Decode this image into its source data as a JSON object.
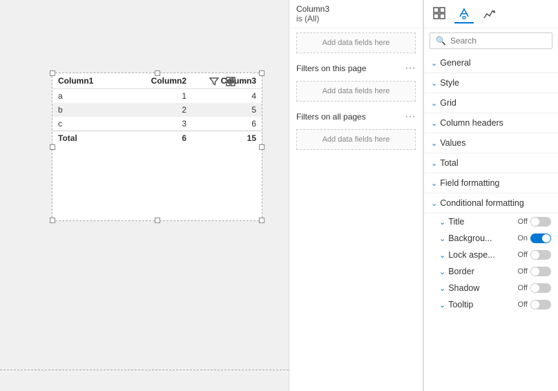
{
  "canvas": {
    "table": {
      "headers": [
        "Column1",
        "Column2",
        "Column3"
      ],
      "rows": [
        {
          "label": "a",
          "col2": "1",
          "col3": "4"
        },
        {
          "label": "b",
          "col2": "2",
          "col3": "5"
        },
        {
          "label": "c",
          "col2": "3",
          "col3": "6"
        }
      ],
      "total_label": "Total",
      "total_col2": "6",
      "total_col3": "15"
    }
  },
  "filters": {
    "items": [
      {
        "name": "Column3",
        "value": "is (All)"
      },
      {
        "name": "",
        "value": "is (All)"
      }
    ],
    "sections": [
      {
        "label": "Filters on this page"
      },
      {
        "label": "Filters on all pages"
      }
    ],
    "add_fields_label": "Add data fields here"
  },
  "format": {
    "search_placeholder": "Search",
    "sections": [
      {
        "label": "General",
        "type": "section"
      },
      {
        "label": "Style",
        "type": "section"
      },
      {
        "label": "Grid",
        "type": "section"
      },
      {
        "label": "Column headers",
        "type": "section"
      },
      {
        "label": "Values",
        "type": "section"
      },
      {
        "label": "Total",
        "type": "section"
      },
      {
        "label": "Field formatting",
        "type": "section"
      },
      {
        "label": "Conditional formatting",
        "type": "section"
      }
    ],
    "toggles": [
      {
        "label": "Title",
        "state": "Off"
      },
      {
        "label": "Backgrou...",
        "state": "On"
      },
      {
        "label": "Lock aspe...",
        "state": "Off"
      },
      {
        "label": "Border",
        "state": "Off"
      },
      {
        "label": "Shadow",
        "state": "Off"
      },
      {
        "label": "Tooltip",
        "state": "Off"
      }
    ]
  }
}
